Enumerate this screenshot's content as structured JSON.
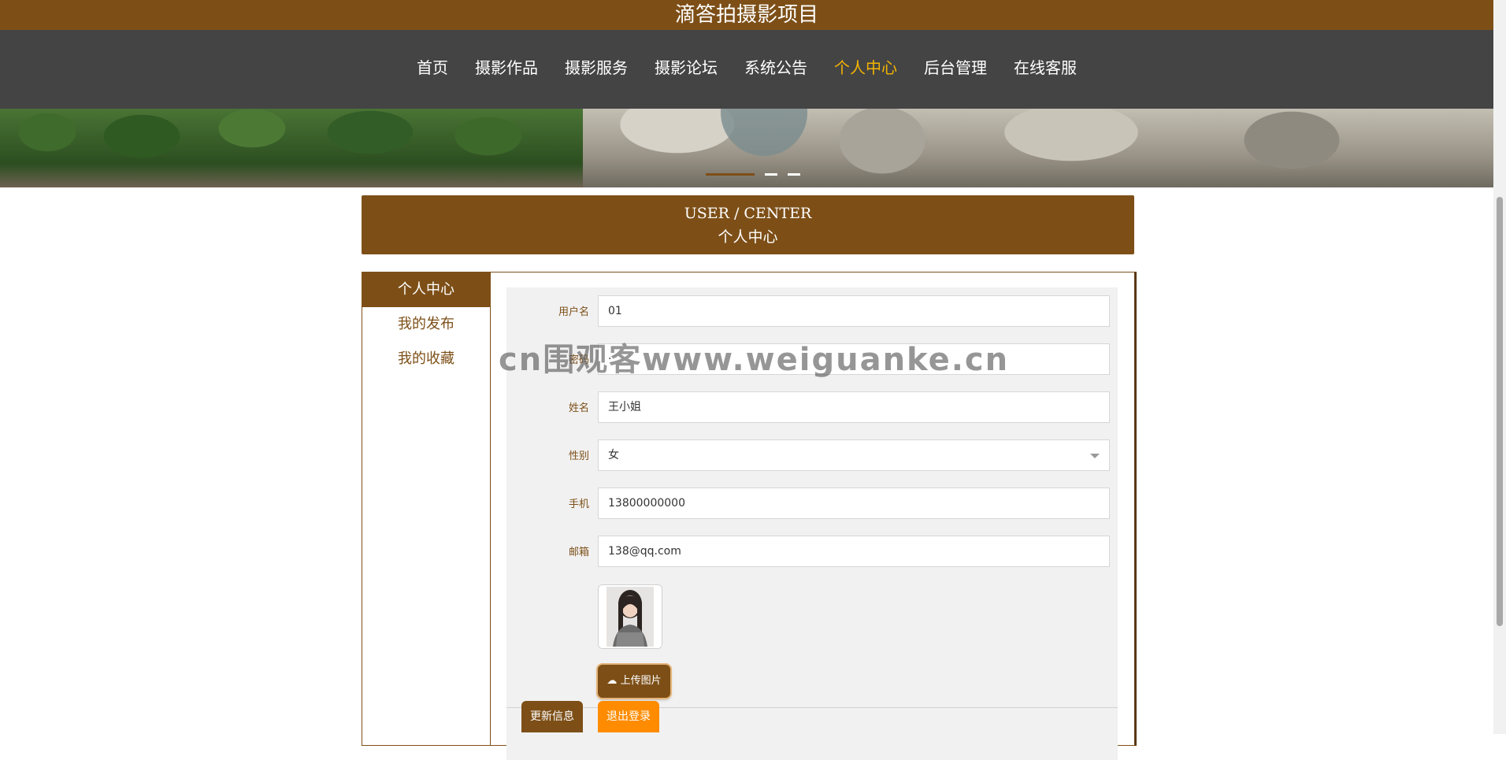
{
  "site": {
    "title": "滴答拍摄影项目"
  },
  "nav": {
    "items": [
      {
        "label": "首页"
      },
      {
        "label": "摄影作品"
      },
      {
        "label": "摄影服务"
      },
      {
        "label": "摄影论坛"
      },
      {
        "label": "系统公告"
      },
      {
        "label": "个人中心",
        "active": true
      },
      {
        "label": "后台管理"
      },
      {
        "label": "在线客服"
      }
    ]
  },
  "header": {
    "en": "USER / CENTER",
    "cn": "个人中心"
  },
  "side_menu": {
    "items": [
      {
        "label": "个人中心",
        "active": true
      },
      {
        "label": "我的发布"
      },
      {
        "label": "我的收藏"
      }
    ]
  },
  "form": {
    "username": {
      "label": "用户名",
      "value": "01"
    },
    "password": {
      "label": "密码",
      "value": "·"
    },
    "name": {
      "label": "姓名",
      "value": "王小姐"
    },
    "gender": {
      "label": "性别",
      "value": "女"
    },
    "phone": {
      "label": "手机",
      "value": "13800000000"
    },
    "email": {
      "label": "邮箱",
      "value": "138@qq.com"
    },
    "upload_label": "上传图片",
    "update_label": "更新信息",
    "logout_label": "退出登录"
  },
  "watermark": "cn围观客www.weiguanke.cn",
  "colors": {
    "brand": "#7d4f17",
    "nav_bg": "#444444",
    "active_nav": "#f4b400",
    "logout": "#ff8c00"
  }
}
